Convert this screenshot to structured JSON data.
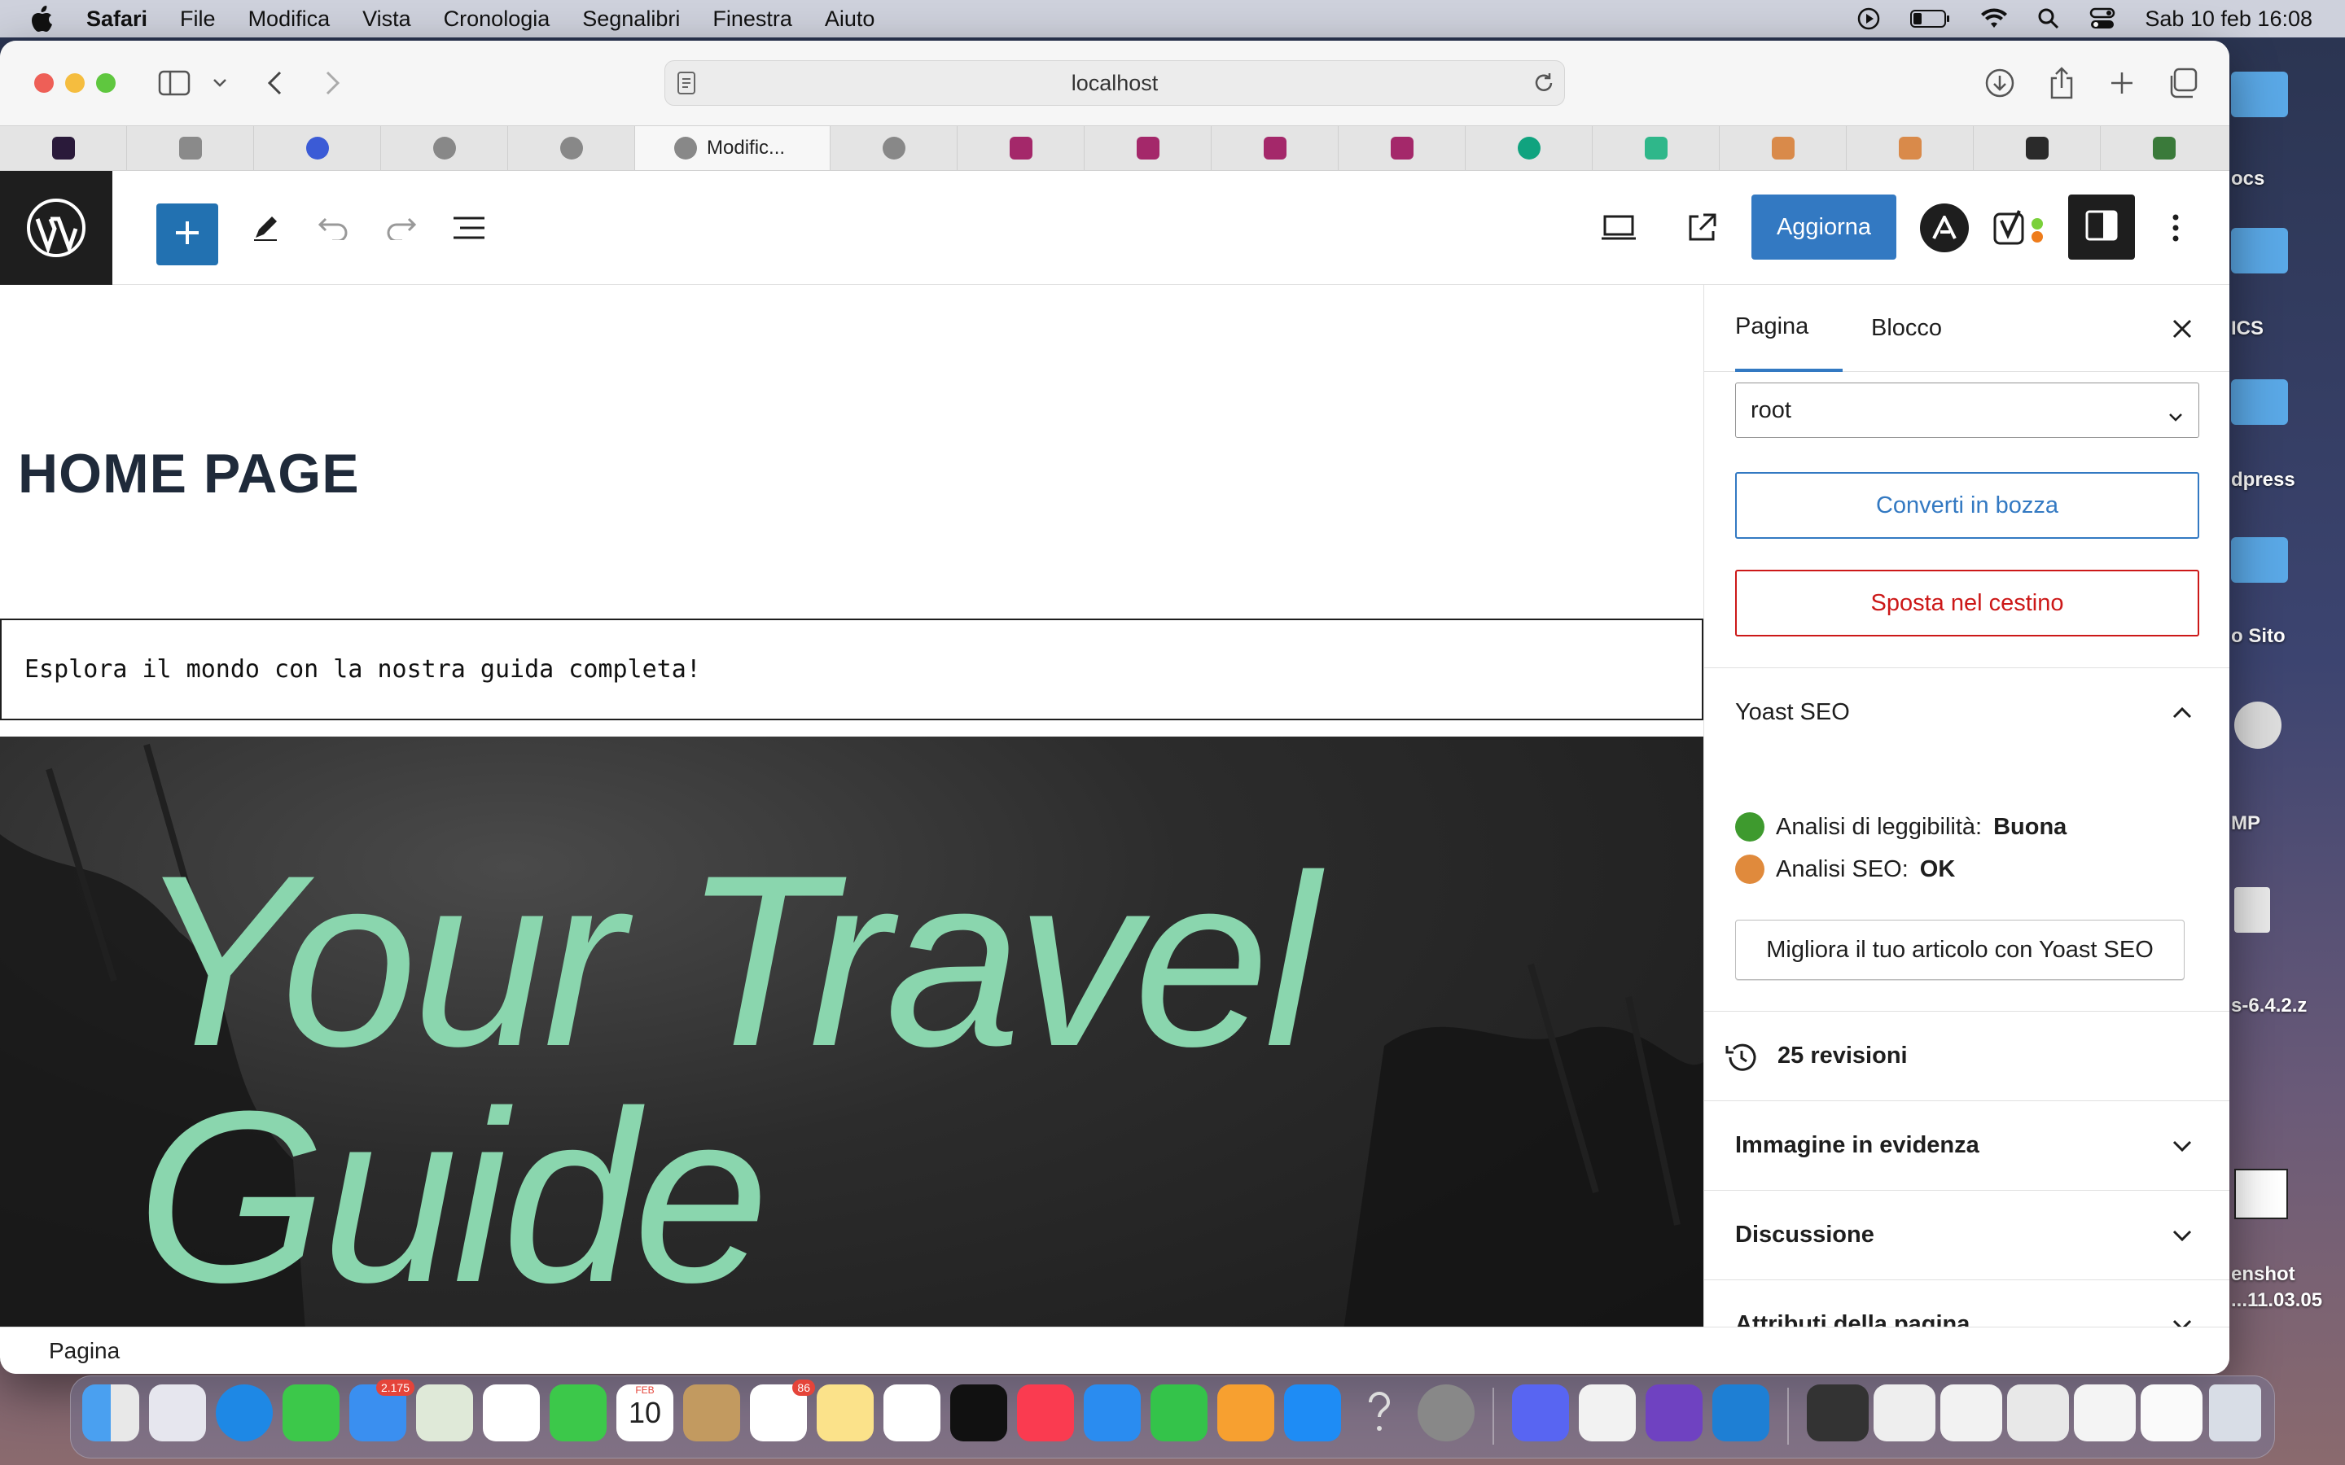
{
  "menubar": {
    "app": "Safari",
    "menus": [
      "File",
      "Modifica",
      "Vista",
      "Cronologia",
      "Segnalibri",
      "Finestra",
      "Aiuto"
    ],
    "clock": "Sab 10 feb  16:08"
  },
  "desktop": {
    "labels": [
      "ocs",
      "ICS",
      "dpress",
      "o Sito",
      "MP",
      "s-6.4.2.z",
      "enshot",
      "...11.03.05"
    ]
  },
  "browser": {
    "url": "localhost",
    "active_tab_title": "Modific..."
  },
  "wp_toolbar": {
    "update_label": "Aggiorna"
  },
  "editor": {
    "page_title": "HOME PAGE",
    "tagline": "Esplora il mondo con la nostra guida completa!",
    "hero_line1": "Your Travel",
    "hero_line2": "Guide",
    "status_breadcrumb": "Pagina"
  },
  "sidebar": {
    "tab_page": "Pagina",
    "tab_block": "Blocco",
    "author_select": "root",
    "convert_draft": "Converti in bozza",
    "move_trash": "Sposta nel cestino",
    "yoast_title": "Yoast SEO",
    "readability_label": "Analisi di leggibilità:",
    "readability_value": "Buona",
    "seo_label": "Analisi SEO:",
    "seo_value": "OK",
    "yoast_button": "Migliora il tuo articolo con Yoast SEO",
    "revisions": "25 revisioni",
    "featured_image": "Immagine in evidenza",
    "discussion": "Discussione",
    "page_attributes": "Attributi della pagina"
  },
  "dock": {
    "mail_badge": "2.175",
    "reminders_badge": "86",
    "calendar_month": "FEB",
    "calendar_day": "10"
  },
  "colors": {
    "wp_blue": "#3379c2",
    "hero_text": "#8ad6ae",
    "trash_red": "#cc1818",
    "yoast_good": "#3e9a2e",
    "yoast_ok": "#e08a3c"
  }
}
